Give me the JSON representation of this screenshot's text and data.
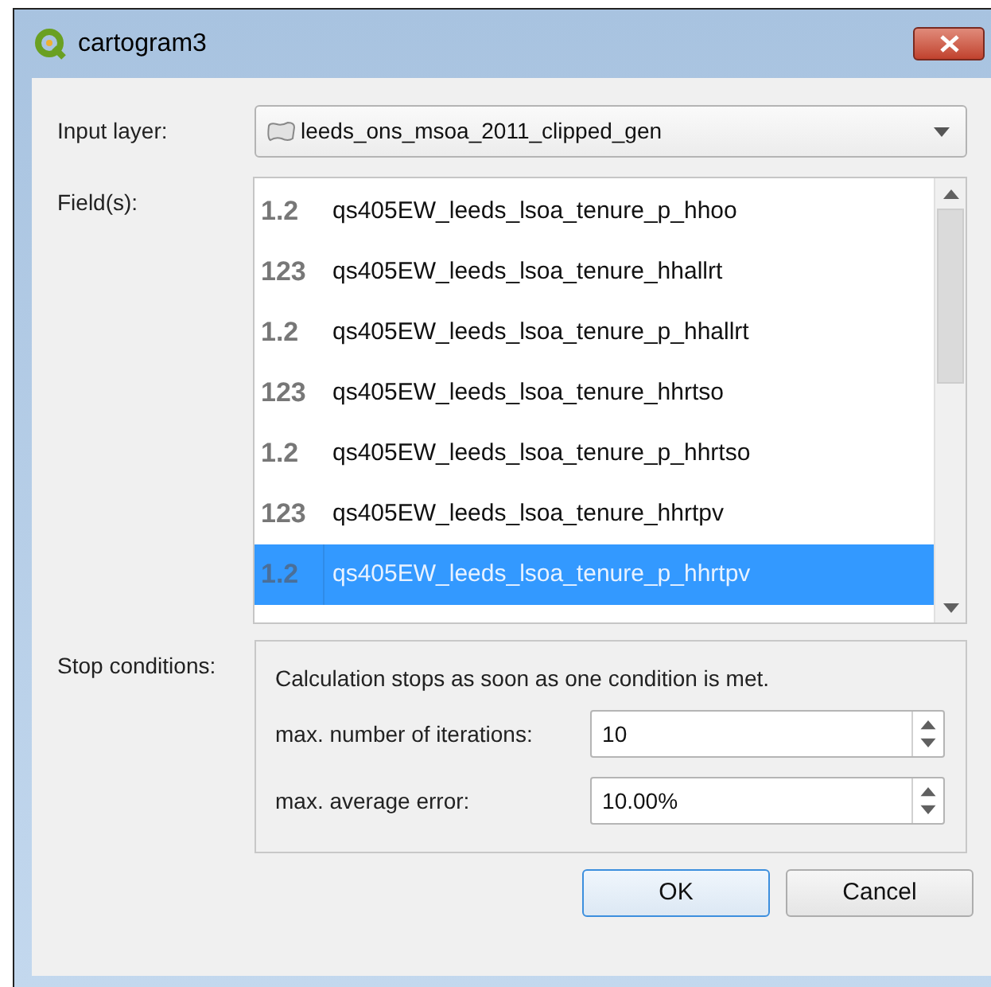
{
  "window": {
    "title": "cartogram3"
  },
  "input_layer": {
    "label": "Input layer:",
    "value": "leeds_ons_msoa_2011_clipped_gen"
  },
  "fields": {
    "label": "Field(s):",
    "items": [
      {
        "type": "1.2",
        "name": "qs405EW_leeds_lsoa_tenure_p_hhoo",
        "selected": false
      },
      {
        "type": "123",
        "name": "qs405EW_leeds_lsoa_tenure_hhallrt",
        "selected": false
      },
      {
        "type": "1.2",
        "name": "qs405EW_leeds_lsoa_tenure_p_hhallrt",
        "selected": false
      },
      {
        "type": "123",
        "name": "qs405EW_leeds_lsoa_tenure_hhrtso",
        "selected": false
      },
      {
        "type": "1.2",
        "name": "qs405EW_leeds_lsoa_tenure_p_hhrtso",
        "selected": false
      },
      {
        "type": "123",
        "name": "qs405EW_leeds_lsoa_tenure_hhrtpv",
        "selected": false
      },
      {
        "type": "1.2",
        "name": "qs405EW_leeds_lsoa_tenure_p_hhrtpv",
        "selected": true
      }
    ]
  },
  "stop_conditions": {
    "label": "Stop conditions:",
    "note": "Calculation stops as soon as one condition is met.",
    "settings": [
      {
        "label": "max. number of iterations:",
        "value": "10"
      },
      {
        "label": "max. average error:",
        "value": "10.00%"
      }
    ]
  },
  "buttons": [
    {
      "label": "OK",
      "default": true
    },
    {
      "label": "Cancel",
      "default": false
    }
  ]
}
